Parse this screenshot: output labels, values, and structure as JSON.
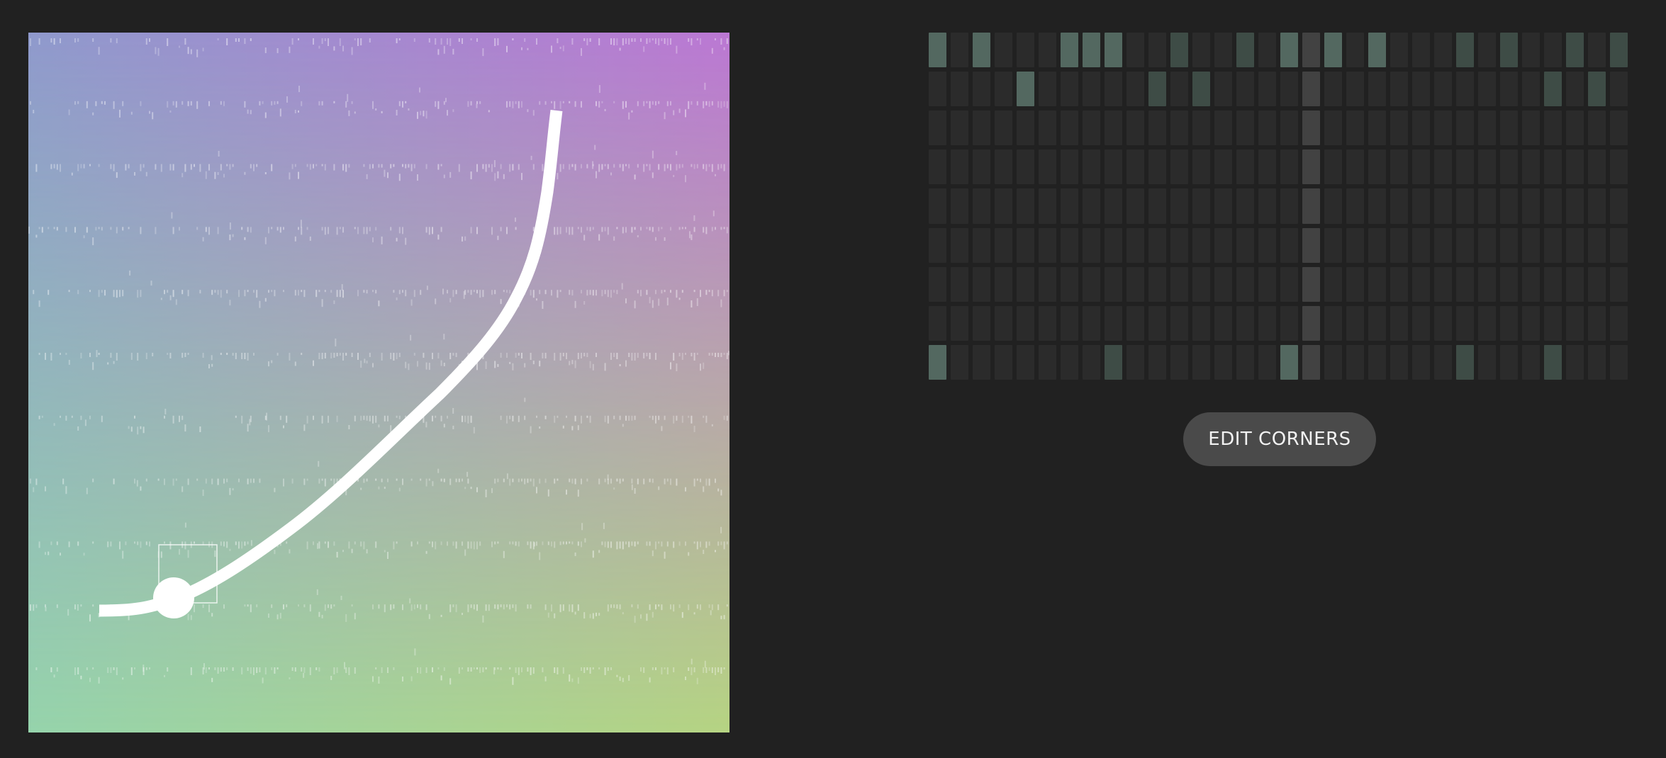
{
  "pad": {
    "corner_colors": {
      "top_left": "#8f99cc",
      "top_right": "#bb77d3",
      "bottom_left": "#96d4ac",
      "bottom_right": "#b6d483"
    },
    "curve_color": "#ffffff",
    "handle_color": "#ffffff",
    "selection_box_color": "#ffffff",
    "sample_noise_seed": 7
  },
  "step_grid": {
    "columns": 32,
    "rows": 9,
    "colors": {
      "off": "#2b2b2b",
      "accent": "#536860",
      "accent_dim": "#3e4c46",
      "highlight": "#424242",
      "highlight_active": "#4b5550"
    },
    "highlight_column": 17,
    "active_cells": [
      [
        0,
        0,
        "accent"
      ],
      [
        0,
        2,
        "accent"
      ],
      [
        0,
        6,
        "accent"
      ],
      [
        0,
        7,
        "accent"
      ],
      [
        0,
        8,
        "accent"
      ],
      [
        0,
        11,
        "accent_dim"
      ],
      [
        0,
        14,
        "accent_dim"
      ],
      [
        0,
        16,
        "accent"
      ],
      [
        0,
        18,
        "accent"
      ],
      [
        0,
        20,
        "accent"
      ],
      [
        0,
        24,
        "accent_dim"
      ],
      [
        0,
        26,
        "accent_dim"
      ],
      [
        0,
        29,
        "accent_dim"
      ],
      [
        0,
        31,
        "accent_dim"
      ],
      [
        1,
        4,
        "accent"
      ],
      [
        1,
        10,
        "accent_dim"
      ],
      [
        1,
        12,
        "accent_dim"
      ],
      [
        1,
        28,
        "accent_dim"
      ],
      [
        1,
        30,
        "accent_dim"
      ],
      [
        8,
        0,
        "accent"
      ],
      [
        8,
        8,
        "accent_dim"
      ],
      [
        8,
        16,
        "accent"
      ],
      [
        8,
        24,
        "accent_dim"
      ],
      [
        8,
        28,
        "accent_dim"
      ]
    ]
  },
  "controls": {
    "edit_corners_label": "EDIT CORNERS"
  }
}
